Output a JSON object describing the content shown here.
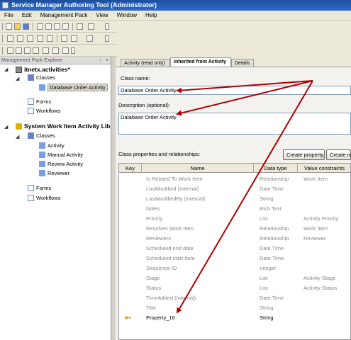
{
  "window": {
    "title": "Service Manager Authoring Tool (Administrator)"
  },
  "menu": [
    "File",
    "Edit",
    "Management Pack",
    "View",
    "Window",
    "Help"
  ],
  "explorer": {
    "header": "Management Pack Explorer",
    "pin": "↑",
    "close": "×",
    "mp1": {
      "name": "itnetx.activities*",
      "classes": "Classes",
      "selected_class": "Database Order Activity",
      "forms": "Forms",
      "workflows": "Workflows"
    },
    "mp2": {
      "name": "System Work Item Activity Lib",
      "classes": "Classes",
      "class_items": [
        "Activity",
        "Manual Activity",
        "Review Activity",
        "Reviewer"
      ],
      "forms": "Forms",
      "workflows": "Workflows"
    }
  },
  "tabs": [
    "Activity (read only)",
    "Inherited from Activity",
    "Details"
  ],
  "form": {
    "class_name_label": "Class name:",
    "class_name_value": "Database Order Activity",
    "description_label": "Description (optional):",
    "description_value": "Database Order Activity",
    "props_label": "Class properties and relationships:",
    "create_property": "Create property...",
    "create_relationship": "Create rel"
  },
  "grid": {
    "headers": [
      "Key",
      "Name",
      "Data type",
      "Value constraints"
    ],
    "rows": [
      {
        "name": "Is Related To Work Item",
        "type": "Relationship",
        "constraint": "Work Item"
      },
      {
        "name": "LastModified (Internal)",
        "type": "Date Time",
        "constraint": ""
      },
      {
        "name": "LastModifiedBy (Internal)",
        "type": "String",
        "constraint": ""
      },
      {
        "name": "Notes",
        "type": "Rich Text",
        "constraint": ""
      },
      {
        "name": "Priority",
        "type": "List",
        "constraint": "Activity Priority"
      },
      {
        "name": "Resolves Work Item",
        "type": "Relationship",
        "constraint": "Work Item"
      },
      {
        "name": "Reviewers",
        "type": "Relationship",
        "constraint": "Reviewer"
      },
      {
        "name": "Scheduled end date",
        "type": "Date Time",
        "constraint": ""
      },
      {
        "name": "Scheduled start date",
        "type": "Date Time",
        "constraint": ""
      },
      {
        "name": "Sequence ID",
        "type": "Integer",
        "constraint": ""
      },
      {
        "name": "Stage",
        "type": "List",
        "constraint": "Activity Stage"
      },
      {
        "name": "Status",
        "type": "List",
        "constraint": "Activity Status"
      },
      {
        "name": "TimeAdded (Internal)",
        "type": "Date Time",
        "constraint": ""
      },
      {
        "name": "Title",
        "type": "String",
        "constraint": ""
      },
      {
        "name": "Property_16",
        "type": "String",
        "constraint": ""
      }
    ]
  },
  "colors": {
    "arrow": "#b00000",
    "titlebar": "#1d4fa0"
  }
}
